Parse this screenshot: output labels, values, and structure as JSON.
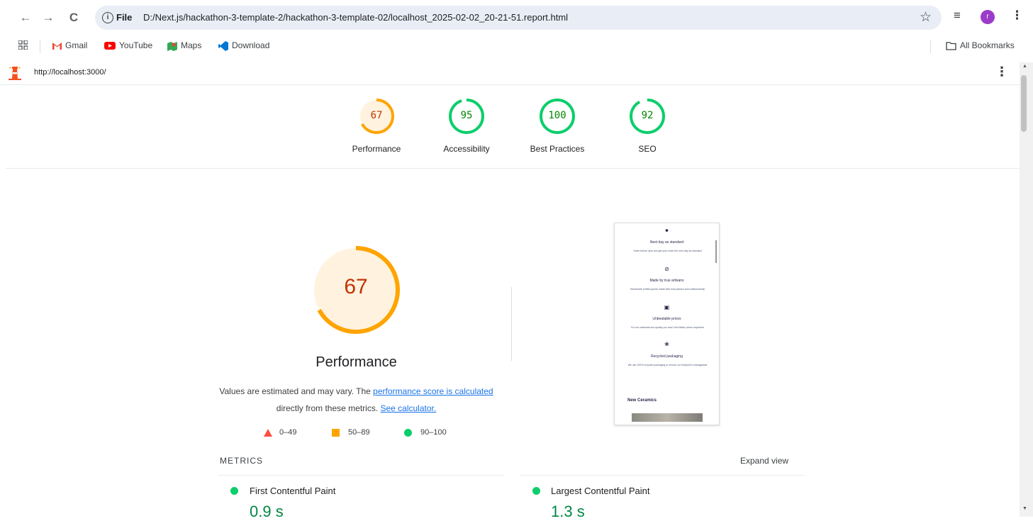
{
  "browser": {
    "nav": {
      "back_icon": "arrow-left-icon",
      "forward_icon": "arrow-right-icon",
      "reload_icon": "reload-icon"
    },
    "omnibox": {
      "scheme_label": "File",
      "url": "D:/Next.js/hackathon-3-template-2/hackathon-3-template-02/localhost_2025-02-02_20-21-51.report.html"
    },
    "avatar_letter": "r",
    "bookmarks": [
      {
        "label": "Gmail",
        "icon": "gmail-icon"
      },
      {
        "label": "YouTube",
        "icon": "youtube-icon"
      },
      {
        "label": "Maps",
        "icon": "maps-icon"
      },
      {
        "label": "Download",
        "icon": "vscode-icon"
      }
    ],
    "all_bookmarks": "All Bookmarks"
  },
  "report": {
    "url": "http://localhost:3000/",
    "colors": {
      "fail": "#ff4e42",
      "average": "#ffa400",
      "pass": "#0cce6b"
    },
    "gauges": [
      {
        "label": "Performance",
        "score": "67",
        "value": 67,
        "color": "#ffa400",
        "bg": "#fff3e0",
        "text_color": "#c33300"
      },
      {
        "label": "Accessibility",
        "score": "95",
        "value": 95,
        "color": "#0cce6b",
        "bg": "#ffffff",
        "text_color": "#008800"
      },
      {
        "label": "Best Practices",
        "score": "100",
        "value": 100,
        "color": "#0cce6b",
        "bg": "#ffffff",
        "text_color": "#008800"
      },
      {
        "label": "SEO",
        "score": "92",
        "value": 92,
        "color": "#0cce6b",
        "bg": "#ffffff",
        "text_color": "#008800"
      }
    ],
    "performance": {
      "score": "67",
      "value": 67,
      "title": "Performance",
      "desc_prefix": "Values are estimated and may vary. The ",
      "desc_link1": "performance score is calculated",
      "desc_middle": " directly from these metrics. ",
      "desc_link2": "See calculator.",
      "legend": [
        {
          "range": "0–49",
          "shape": "triangle"
        },
        {
          "range": "50–89",
          "shape": "square"
        },
        {
          "range": "90–100",
          "shape": "circle"
        }
      ]
    },
    "screenshot": {
      "items": [
        {
          "icon": "delivery-icon",
          "heading": "Next day as standard",
          "text": "Order before 3pm and get your order the next day as standard"
        },
        {
          "icon": "checkmark-icon",
          "heading": "Made by true artisans",
          "text": "Handmade crafted goods made with real passion and craftsmanship"
        },
        {
          "icon": "card-icon",
          "heading": "Unbeatable prices",
          "text": "For our materials and quality you won't find better prices anywhere"
        },
        {
          "icon": "plant-icon",
          "heading": "Recycled packaging",
          "text": "We use 100% recycled packaging to ensure our footprint is manageable"
        }
      ],
      "section_title": "New Ceramics"
    },
    "metrics_label": "METRICS",
    "expand_label": "Expand view",
    "metrics": [
      {
        "name": "First Contentful Paint",
        "value": "0.9 s"
      },
      {
        "name": "Largest Contentful Paint",
        "value": "1.3 s"
      }
    ]
  }
}
